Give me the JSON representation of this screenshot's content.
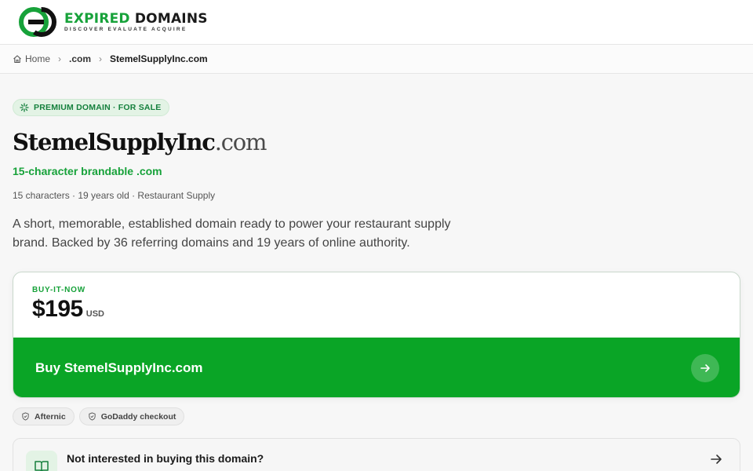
{
  "brand": {
    "name_part1": "EXPIRED",
    "name_part2": "DOMAINS",
    "tagline": "DISCOVER EVALUATE ACQUIRE",
    "accent_color": "#17a23a"
  },
  "breadcrumb": {
    "items": [
      {
        "label": "Home",
        "icon": "home-icon"
      },
      {
        "label": ".com"
      },
      {
        "label": "StemelSupplyInc.com"
      }
    ]
  },
  "badge": {
    "icon": "sparkle-icon",
    "label": "PREMIUM DOMAIN · FOR SALE"
  },
  "domain": {
    "name": "StemelSupplyInc",
    "tld": ".com",
    "subtitle": "15-character brandable .com",
    "meta": "15 characters · 19 years old · Restaurant Supply",
    "description": "A short, memorable, established domain ready to power your restaurant supply brand. Backed by 36 referring domains and 19 years of online authority."
  },
  "pricing": {
    "label": "BUY-IT-NOW",
    "amount": "$195",
    "currency": "USD",
    "buy_label": "Buy StemelSupplyInc.com",
    "button_color": "#0aa526"
  },
  "chips": [
    {
      "label": "Afternic",
      "icon": "shield-icon"
    },
    {
      "label": "GoDaddy checkout",
      "icon": "shield-icon"
    }
  ],
  "alternative": {
    "icon": "book-icon",
    "label": "Not interested in buying this domain?"
  }
}
